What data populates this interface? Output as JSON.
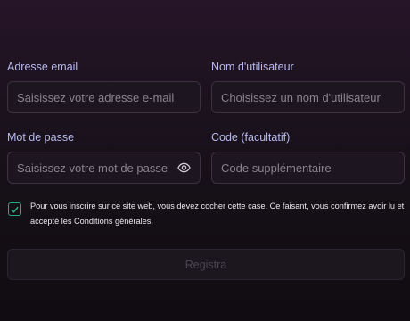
{
  "form": {
    "email": {
      "label": "Adresse email",
      "placeholder": "Saisissez votre adresse e-mail",
      "value": ""
    },
    "username": {
      "label": "Nom d'utilisateur",
      "placeholder": "Choisissez un nom d'utilisateur",
      "value": ""
    },
    "password": {
      "label": "Mot de passe",
      "placeholder": "Saisissez votre mot de passe",
      "value": "",
      "toggle_icon": "eye-icon"
    },
    "code": {
      "label": "Code (facultatif)",
      "placeholder": "Code supplémentaire",
      "value": ""
    },
    "consent": {
      "checked": true,
      "text": "Pour vous inscrire sur ce site web, vous devez cocher cette case. Ce faisant, vous confirmez avoir lu et accepté les Conditions générales."
    },
    "submit_label": "Registra"
  },
  "colors": {
    "label": "#b7b9ec",
    "accent_checkbox": "#2fa77d",
    "input_border": "#3b3140",
    "background_top": "#261428",
    "background_bottom": "#100c11"
  }
}
